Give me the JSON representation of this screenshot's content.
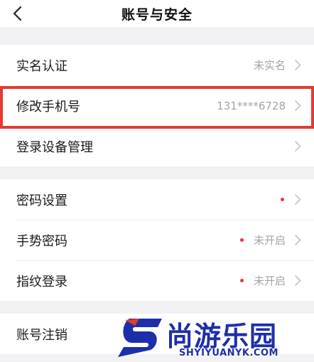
{
  "header": {
    "title": "账号与安全"
  },
  "group1": {
    "items": [
      {
        "label": "实名认证",
        "value": "未实名"
      },
      {
        "label": "修改手机号",
        "value": "131****6728"
      },
      {
        "label": "登录设备管理",
        "value": ""
      }
    ]
  },
  "group2": {
    "items": [
      {
        "label": "密码设置",
        "value": ""
      },
      {
        "label": "手势密码",
        "value": "未开启"
      },
      {
        "label": "指纹登录",
        "value": "未开启"
      }
    ]
  },
  "group3": {
    "items": [
      {
        "label": "账号注销"
      }
    ]
  },
  "watermark": {
    "title": "尚游乐园",
    "url": "SHYIYUANYK.COM",
    "logo_letter": "S"
  },
  "colors": {
    "highlight": "#e23b30",
    "dot": "#e8353a",
    "watermark": "#1d2fa8",
    "value_text": "#a3a3a8"
  }
}
